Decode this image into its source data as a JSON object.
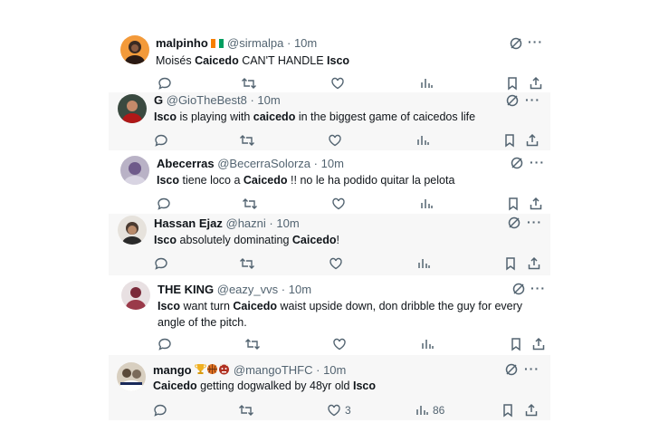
{
  "tweets": [
    {
      "name": "malpinho",
      "handle": "@sirmalpa",
      "sep": "·",
      "time": "10m",
      "body": [
        {
          "t": "Moisés "
        },
        {
          "t": "Caicedo",
          "b": true
        },
        {
          "t": " CAN'T HANDLE "
        },
        {
          "t": "Isco",
          "b": true
        }
      ],
      "likes": "",
      "views": ""
    },
    {
      "name": "G",
      "handle": "@GioTheBest8",
      "sep": "·",
      "time": "10m",
      "body": [
        {
          "t": "Isco",
          "b": true
        },
        {
          "t": " is playing with "
        },
        {
          "t": "caicedo",
          "b": true
        },
        {
          "t": " in the biggest game of caicedos life"
        }
      ],
      "likes": "",
      "views": ""
    },
    {
      "name": "Abecerras",
      "handle": "@BecerraSolorza",
      "sep": "·",
      "time": "10m",
      "body": [
        {
          "t": "Isco",
          "b": true
        },
        {
          "t": " tiene loco a "
        },
        {
          "t": "Caicedo",
          "b": true
        },
        {
          "t": " !! no le ha podido quitar la pelota"
        }
      ],
      "likes": "",
      "views": ""
    },
    {
      "name": "Hassan Ejaz",
      "handle": "@hazni",
      "sep": "·",
      "time": "10m",
      "body": [
        {
          "t": "Isco",
          "b": true
        },
        {
          "t": " absolutely dominating "
        },
        {
          "t": "Caicedo",
          "b": true
        },
        {
          "t": "!"
        }
      ],
      "likes": "",
      "views": ""
    },
    {
      "name": "THE KING",
      "handle": "@eazy_vvs",
      "sep": "·",
      "time": "10m",
      "body": [
        {
          "t": "Isco",
          "b": true
        },
        {
          "t": " want turn "
        },
        {
          "t": "Caicedo",
          "b": true
        },
        {
          "t": " waist upside down, don dribble the guy for every angle of the pitch."
        }
      ],
      "likes": "",
      "views": ""
    },
    {
      "name": "mango",
      "handle": "@mangoTHFC",
      "sep": "·",
      "time": "10m",
      "body": [
        {
          "t": "Caicedo",
          "b": true
        },
        {
          "t": " getting dogwalked by 48yr old "
        },
        {
          "t": "Isco",
          "b": true
        }
      ],
      "likes": "3",
      "views": "86"
    }
  ],
  "colors": {
    "muted": "#536471",
    "text": "#0f1419",
    "alt_bg": "#f7f7f7"
  },
  "icons": [
    "reply-icon",
    "retweet-icon",
    "like-icon",
    "views-icon",
    "bookmark-icon",
    "share-icon",
    "grok-icon",
    "more-icon"
  ]
}
